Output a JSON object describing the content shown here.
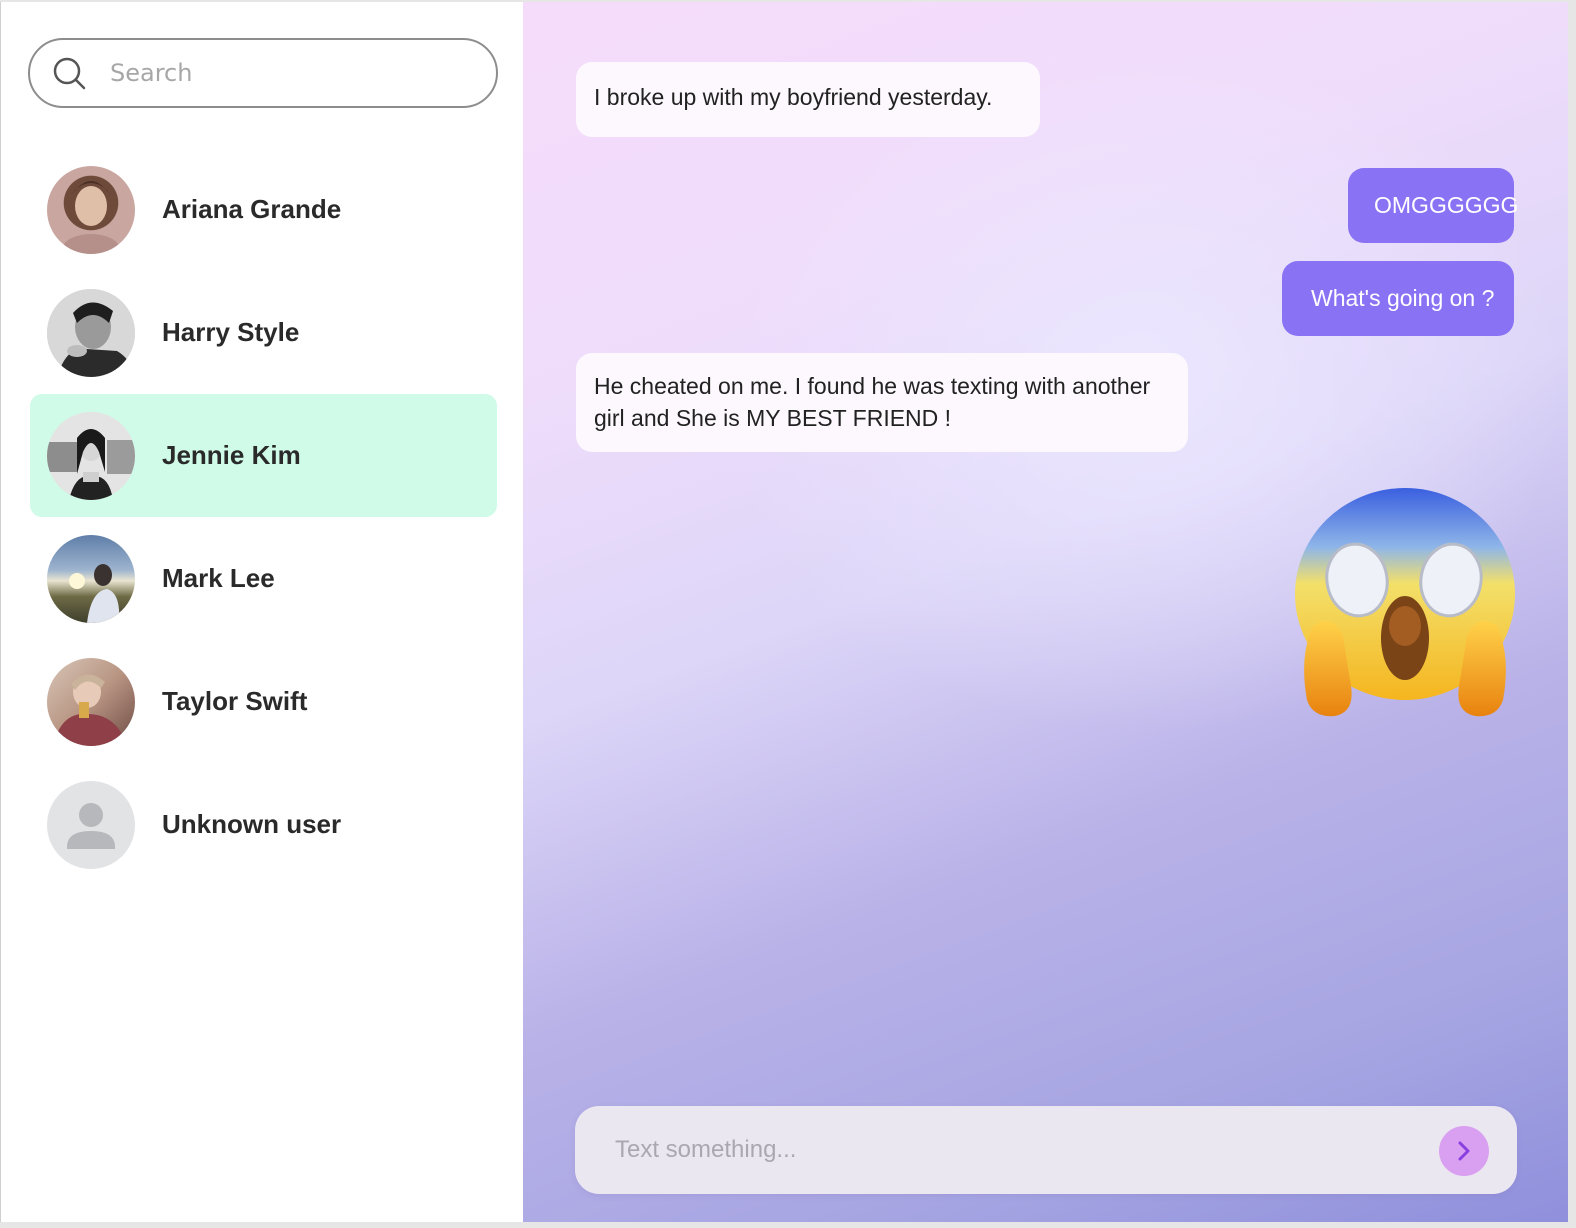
{
  "search": {
    "placeholder": "Search"
  },
  "contacts": [
    {
      "name": "Ariana Grande",
      "active": false
    },
    {
      "name": "Harry Style",
      "active": false
    },
    {
      "name": "Jennie Kim",
      "active": true
    },
    {
      "name": "Mark Lee",
      "active": false
    },
    {
      "name": "Taylor Swift",
      "active": false
    },
    {
      "name": "Unknown user",
      "active": false
    }
  ],
  "messages": [
    {
      "direction": "incoming",
      "text": "I broke up with my boyfriend yesterday."
    },
    {
      "direction": "outgoing",
      "text": "OMGGGGGG"
    },
    {
      "direction": "outgoing",
      "text": "What's going on ?"
    },
    {
      "direction": "incoming",
      "text": "He cheated on me. I found he was texting with another girl and She is MY BEST FRIEND !"
    },
    {
      "direction": "outgoing",
      "type": "emoji",
      "icon": "screaming-in-fear-emoji"
    }
  ],
  "composer": {
    "placeholder": "Text something...",
    "send_icon": "chevron-right-icon"
  },
  "colors": {
    "active_contact_bg": "#cffbe8",
    "outgoing_bubble": "#8a72f5",
    "incoming_bubble": "#fcf8fd",
    "send_button": "#d99ff0"
  }
}
